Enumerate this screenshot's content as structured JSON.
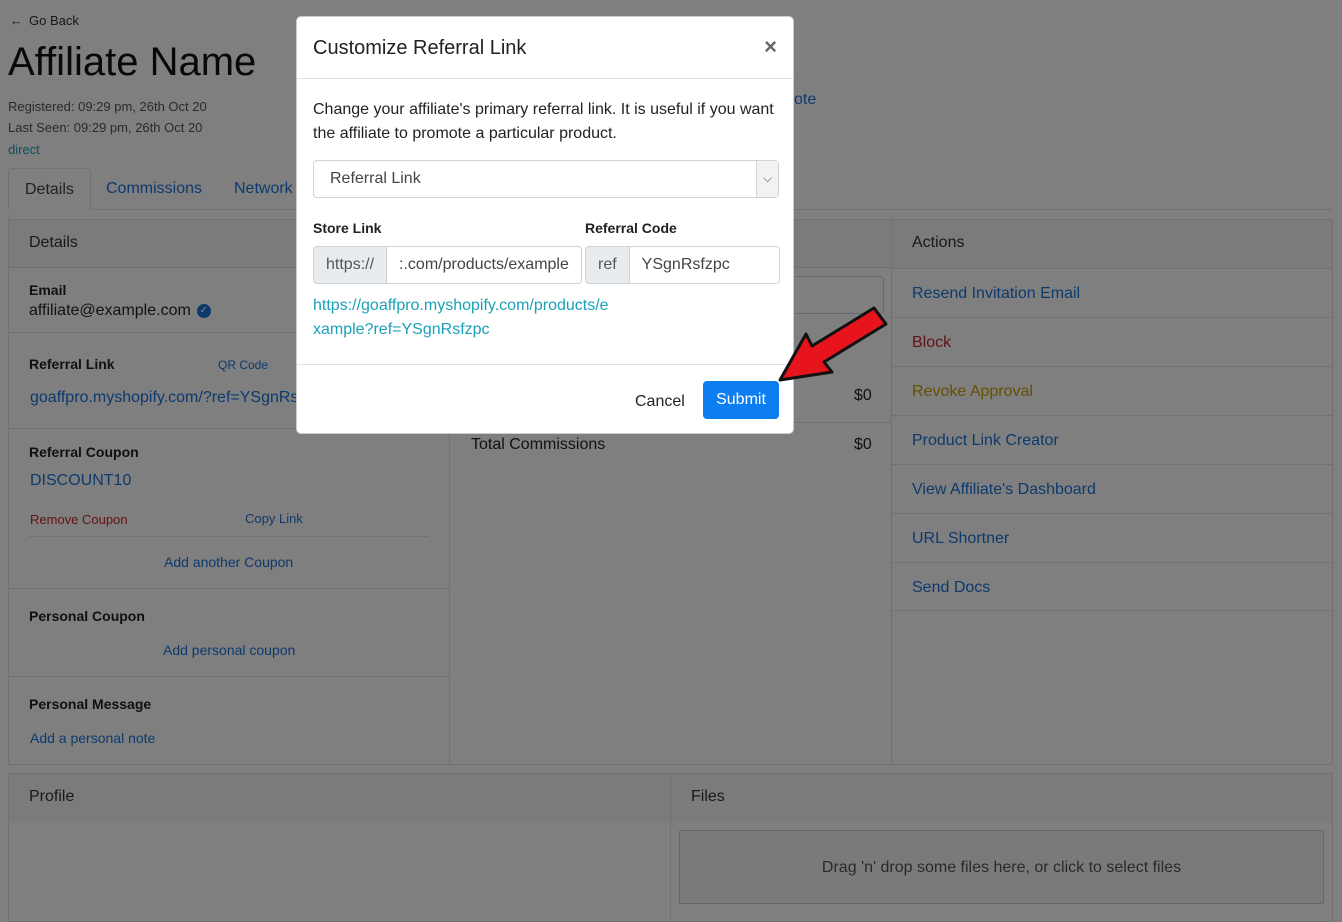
{
  "nav": {
    "go_back": "Go Back"
  },
  "header": {
    "title": "Affiliate Name",
    "registered": "Registered: 09:29 pm, 26th Oct 20",
    "last_seen": "Last Seen: 09:29 pm, 26th Oct 20",
    "source": "direct",
    "note_link": "ote"
  },
  "tabs": [
    "Details",
    "Commissions",
    "Network"
  ],
  "details": {
    "heading": "Details",
    "email_label": "Email",
    "email": "affiliate@example.com",
    "referral_link_label": "Referral Link",
    "qr_code": "QR Code",
    "referral_link": "goaffpro.myshopify.com/?ref=YSgnRs",
    "referral_coupon_label": "Referral Coupon",
    "coupon": "DISCOUNT10",
    "remove_coupon": "Remove Coupon",
    "copy_link": "Copy Link",
    "add_another_coupon": "Add another Coupon",
    "personal_coupon_label": "Personal Coupon",
    "add_personal_coupon": "Add personal coupon",
    "personal_message_label": "Personal Message",
    "add_personal_note": "Add a personal note"
  },
  "stats": {
    "row_value": "$0",
    "total_label": "Total Commissions",
    "total_value": "$0"
  },
  "actions": {
    "heading": "Actions",
    "items": [
      {
        "label": "Resend Invitation Email",
        "color": "#1a73d9"
      },
      {
        "label": "Block",
        "color": "#c82333"
      },
      {
        "label": "Revoke Approval",
        "color": "#c9a000"
      },
      {
        "label": "Product Link Creator",
        "color": "#1a73d9"
      },
      {
        "label": "View Affiliate's Dashboard",
        "color": "#1a73d9"
      },
      {
        "label": "URL Shortner",
        "color": "#1a73d9"
      },
      {
        "label": "Send Docs",
        "color": "#1a73d9"
      }
    ]
  },
  "profile": {
    "heading": "Profile"
  },
  "files": {
    "heading": "Files",
    "dropzone": "Drag 'n' drop some files here, or click to select files"
  },
  "modal": {
    "title": "Customize Referral Link",
    "close": "×",
    "description": "Change your affiliate's primary referral link. It is useful if you want the affiliate to promote a particular product.",
    "select_value": "Referral Link",
    "store_link_label": "Store Link",
    "store_prefix": "https://",
    "store_value": ":.com/products/example",
    "referral_code_label": "Referral Code",
    "ref_prefix": "ref",
    "ref_value": "YSgnRsfzpc",
    "preview_url": "https://goaffpro.myshopify.com/products/example?ref=YSgnRsfzpc",
    "cancel": "Cancel",
    "submit": "Submit"
  },
  "colors": {
    "accent": "#1a73d9",
    "submit": "#0d7ef2",
    "annotation_arrow": "#e8141d"
  }
}
